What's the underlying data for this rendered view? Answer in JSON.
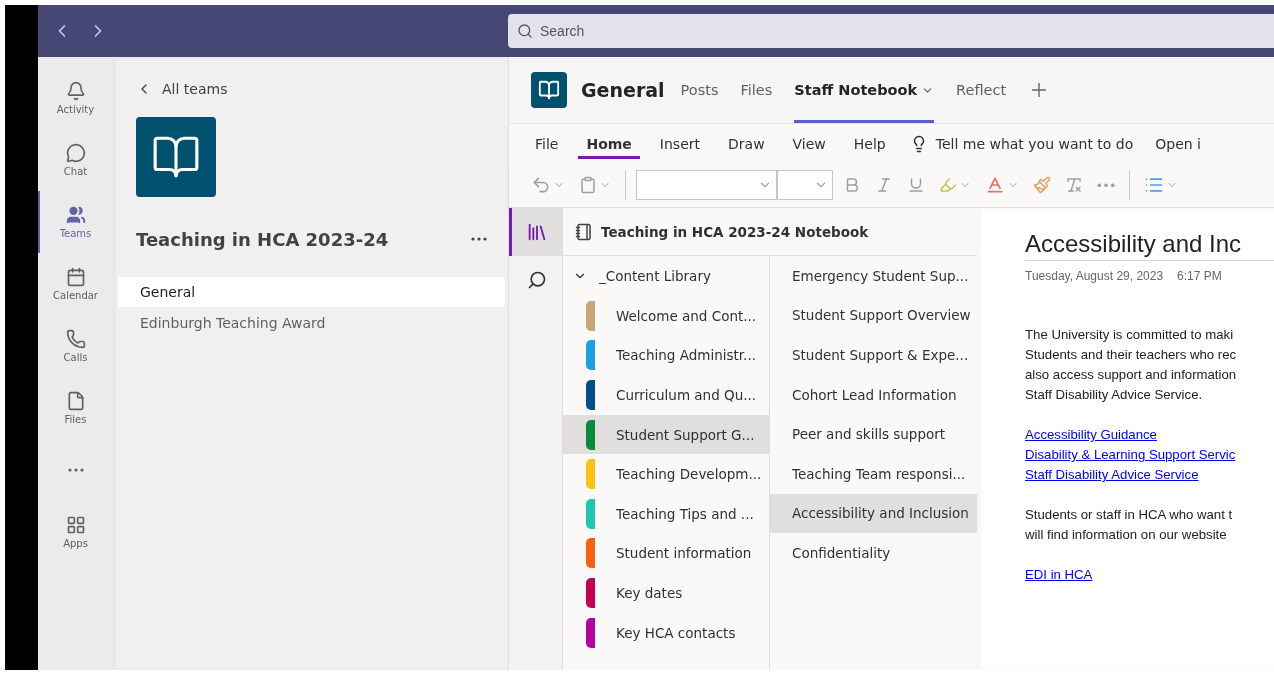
{
  "search": {
    "placeholder": "Search"
  },
  "rail": [
    {
      "kind": "bell",
      "label": "Activity",
      "selected": false
    },
    {
      "kind": "chat",
      "label": "Chat",
      "selected": false
    },
    {
      "kind": "teams",
      "label": "Teams",
      "selected": true
    },
    {
      "kind": "calendar",
      "label": "Calendar",
      "selected": false
    },
    {
      "kind": "calls",
      "label": "Calls",
      "selected": false
    },
    {
      "kind": "files",
      "label": "Files",
      "selected": false
    },
    {
      "kind": "more",
      "selected": false
    },
    {
      "kind": "apps",
      "label": "Apps",
      "selected": false
    }
  ],
  "team_panel": {
    "back_label": "All teams",
    "name": "Teaching in HCA 2023-24",
    "channels": [
      {
        "label": "General",
        "selected": true
      },
      {
        "label": "Edinburgh Teaching Award",
        "selected": false
      }
    ]
  },
  "channel_header": {
    "title": "General",
    "tabs": [
      {
        "label": "Posts",
        "selected": false,
        "dropdown": false
      },
      {
        "label": "Files",
        "selected": false,
        "dropdown": false
      },
      {
        "label": "Staff Notebook",
        "selected": true,
        "dropdown": true
      },
      {
        "label": "Reflect",
        "selected": false,
        "dropdown": false
      }
    ]
  },
  "ribbon": {
    "tabs": [
      {
        "label": "File",
        "selected": false
      },
      {
        "label": "Home",
        "selected": true
      },
      {
        "label": "Insert",
        "selected": false
      },
      {
        "label": "Draw",
        "selected": false
      },
      {
        "label": "View",
        "selected": false
      },
      {
        "label": "Help",
        "selected": false
      }
    ],
    "tell_me": "Tell me what you want to do",
    "open_in": "Open i"
  },
  "nav_strip": [
    {
      "kind": "notebooks",
      "selected": true
    },
    {
      "kind": "search",
      "selected": false
    }
  ],
  "notebook": {
    "title": "Teaching in HCA 2023-24 Notebook",
    "section_group": {
      "label": "_Content Library",
      "expanded": true
    },
    "sections": [
      {
        "label": "Welcome and Cont...",
        "color": "#c8a67a",
        "selected": false
      },
      {
        "label": "Teaching Administr...",
        "color": "#1ba1e2",
        "selected": false
      },
      {
        "label": "Curriculum and Qu...",
        "color": "#004e8c",
        "selected": false
      },
      {
        "label": "Student Support G...",
        "color": "#0b8a3e",
        "selected": true
      },
      {
        "label": "Teaching Developm...",
        "color": "#ffc20e",
        "selected": false
      },
      {
        "label": "Teaching Tips and ...",
        "color": "#1fc8b0",
        "selected": false
      },
      {
        "label": "Student information",
        "color": "#f7630c",
        "selected": false
      },
      {
        "label": "Key dates",
        "color": "#c30052",
        "selected": false
      },
      {
        "label": "Key HCA contacts",
        "color": "#b4009e",
        "selected": false
      }
    ],
    "pages": [
      {
        "label": "Emergency Student Sup...",
        "selected": false
      },
      {
        "label": "Student Support Overview",
        "selected": false
      },
      {
        "label": "Student Support & Expe...",
        "selected": false
      },
      {
        "label": "Cohort Lead Information",
        "selected": false
      },
      {
        "label": "Peer and skills support",
        "selected": false
      },
      {
        "label": "Teaching Team responsi...",
        "selected": false
      },
      {
        "label": "Accessibility and Inclusion",
        "selected": true
      },
      {
        "label": "Confidentiality",
        "selected": false
      }
    ]
  },
  "page": {
    "title": "Accessibility and Inc",
    "date": "Tuesday, August 29, 2023",
    "time": "6:17 PM",
    "paragraph_1": [
      "The University is committed to maki",
      "Students and their teachers who rec",
      "also access support and information",
      "Staff Disability Advice Service."
    ],
    "links": [
      "Accessibility Guidance",
      "Disability & Learning Support Servic",
      "Staff Disability Advice Service"
    ],
    "paragraph_2": [
      "Students or staff in HCA who want t",
      "will find information on our website"
    ],
    "link_2": "EDI in HCA"
  }
}
